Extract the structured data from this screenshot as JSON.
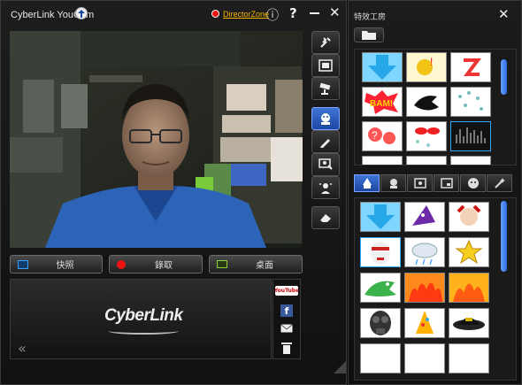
{
  "app": {
    "title": "CyberLink YouCam",
    "director_zone": "DirectorZone",
    "info_glyph": "ⓘ",
    "help_glyph": "?",
    "min_glyph": "—",
    "close_glyph": "✕"
  },
  "buttons": {
    "snapshot": "快照",
    "record": "錄取",
    "desktop": "桌面"
  },
  "panel": {
    "logo_text": "CyberLink",
    "back_glyph": "«",
    "youtube": "YouTube",
    "facebook": "f"
  },
  "effects": {
    "title": "特效工房",
    "close_glyph": "✕"
  },
  "colors": {
    "accent": "#2f66d0",
    "record": "#e11",
    "snapshot_icon": "#3aa0ff",
    "desktop_icon": "#8bd13a"
  },
  "icons": [
    "info-icon",
    "help-icon",
    "minimize-icon",
    "close-icon",
    "tools-icon",
    "screen-icon",
    "cctv-icon",
    "avatar-effects-icon",
    "pencil-icon",
    "gadget-icon",
    "face-tracking-icon",
    "eraser-icon",
    "youtube-icon",
    "facebook-icon",
    "email-icon",
    "trash-icon",
    "folder-icon"
  ]
}
